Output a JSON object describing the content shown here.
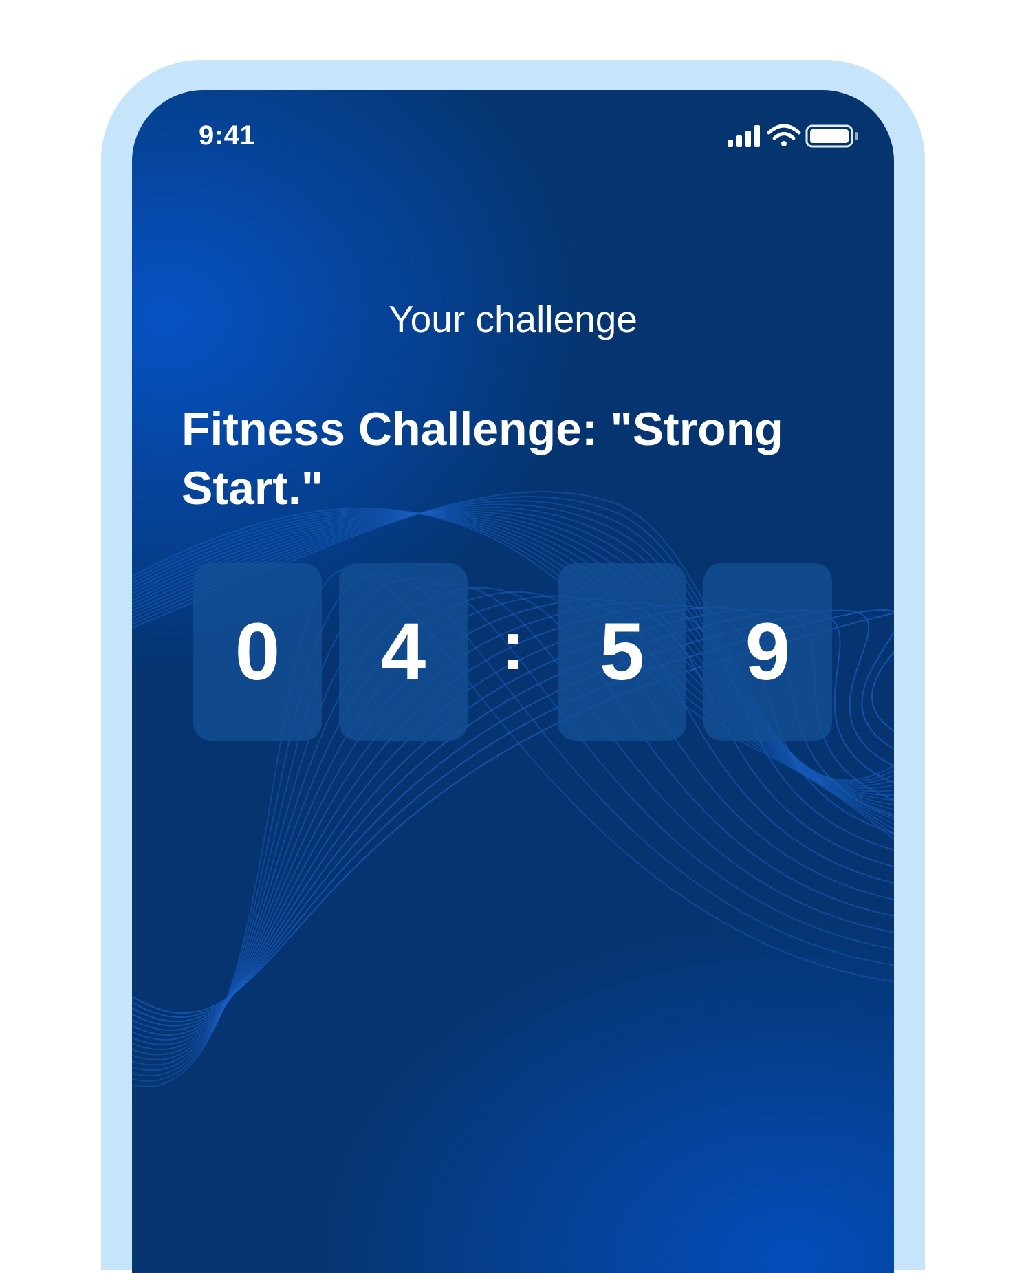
{
  "status_bar": {
    "time": "9:41",
    "icons": [
      "signal-icon",
      "wifi-icon",
      "battery-icon"
    ]
  },
  "header": {
    "title": "Your challenge"
  },
  "challenge": {
    "name": "Fitness Challenge: \"Strong Start.\""
  },
  "timer": {
    "digits": [
      "0",
      "4",
      "5",
      "9"
    ],
    "separator": ":"
  },
  "colors": {
    "frame": "#c6e5fb",
    "background_dark": "#05356f",
    "background_glow": "#0654c8",
    "digit_card": "#144f96",
    "text": "#ffffff"
  }
}
